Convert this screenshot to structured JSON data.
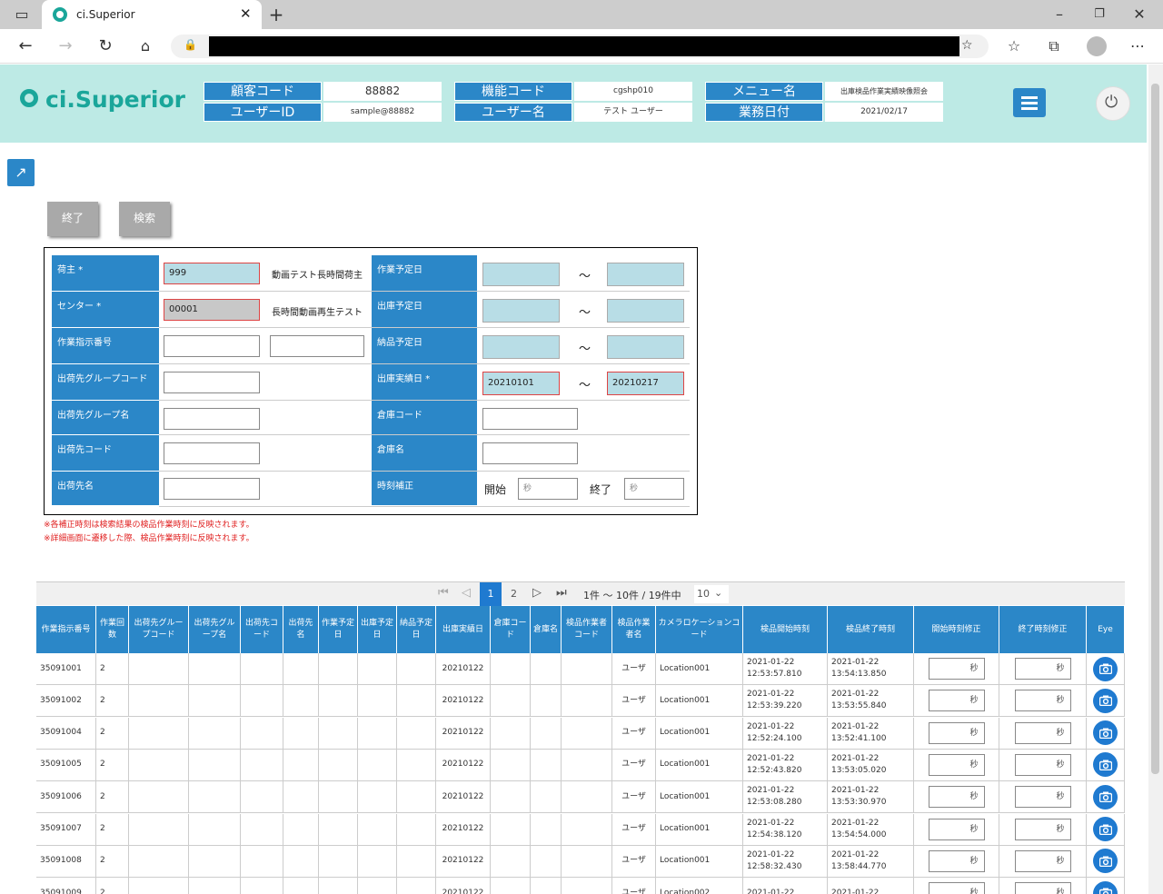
{
  "browser": {
    "tab_title": "ci.Superior"
  },
  "header": {
    "logo": "ci.Superior",
    "fields": [
      {
        "label": "顧客コード",
        "value": "88882"
      },
      {
        "label": "ユーザーID",
        "value": "sample@88882"
      },
      {
        "label": "機能コード",
        "value": "cgshp010"
      },
      {
        "label": "ユーザー名",
        "value": "テスト ユーザー"
      },
      {
        "label": "メニュー名",
        "value": "出庫検品作業実績映像照会"
      },
      {
        "label": "業務日付",
        "value": "2021/02/17"
      }
    ]
  },
  "toolbar": {
    "end_label": "終了",
    "search_label": "検索"
  },
  "form": {
    "shipper_label": "荷主 *",
    "shipper_value": "999",
    "shipper_name": "動画テスト長時間荷主",
    "center_label": "センター *",
    "center_value": "00001",
    "center_name": "長時間動画再生テスト",
    "work_order_label": "作業指示番号",
    "dest_group_code_label": "出荷先グループコード",
    "dest_group_name_label": "出荷先グループ名",
    "dest_code_label": "出荷先コード",
    "dest_name_label": "出荷先名",
    "work_sched_label": "作業予定日",
    "ship_sched_label": "出庫予定日",
    "deliv_sched_label": "納品予定日",
    "ship_actual_label": "出庫実績日 *",
    "ship_actual_from": "20210101",
    "ship_actual_to": "20210217",
    "warehouse_code_label": "倉庫コード",
    "warehouse_name_label": "倉庫名",
    "time_adj_label": "時刻補正",
    "start_label": "開始",
    "end_label": "終了",
    "sec_placeholder": "秒",
    "tilde": "～"
  },
  "notes": [
    "※各補正時刻は検索結果の検品作業時刻に反映されます。",
    "※詳細画面に遷移した際、検品作業時刻に反映されます。"
  ],
  "pager": {
    "current_page": "1",
    "next_page": "2",
    "summary": "1件 ～ 10件 / 19件中",
    "page_size": "10"
  },
  "table": {
    "headers": [
      "作業指示番号",
      "作業回数",
      "出荷先グループコード",
      "出荷先グループ名",
      "出荷先コード",
      "出荷先名",
      "作業予定日",
      "出庫予定日",
      "納品予定日",
      "出庫実績日",
      "倉庫コード",
      "倉庫名",
      "検品作業者コード",
      "検品作業者名",
      "カメラロケーションコード",
      "検品開始時刻",
      "検品終了時刻",
      "開始時刻修正",
      "終了時刻修正",
      "Eye"
    ],
    "sec_placeholder": "秒",
    "rows": [
      {
        "order": "35091001",
        "count": "2",
        "actual": "20210122",
        "worker": "ユーザ",
        "loc": "Location001",
        "start1": "2021-01-22",
        "start2": "12:53:57.810",
        "end1": "2021-01-22",
        "end2": "13:54:13.850"
      },
      {
        "order": "35091002",
        "count": "2",
        "actual": "20210122",
        "worker": "ユーザ",
        "loc": "Location001",
        "start1": "2021-01-22",
        "start2": "12:53:39.220",
        "end1": "2021-01-22",
        "end2": "13:53:55.840"
      },
      {
        "order": "35091004",
        "count": "2",
        "actual": "20210122",
        "worker": "ユーザ",
        "loc": "Location001",
        "start1": "2021-01-22",
        "start2": "12:52:24.100",
        "end1": "2021-01-22",
        "end2": "13:52:41.100"
      },
      {
        "order": "35091005",
        "count": "2",
        "actual": "20210122",
        "worker": "ユーザ",
        "loc": "Location001",
        "start1": "2021-01-22",
        "start2": "12:52:43.820",
        "end1": "2021-01-22",
        "end2": "13:53:05.020"
      },
      {
        "order": "35091006",
        "count": "2",
        "actual": "20210122",
        "worker": "ユーザ",
        "loc": "Location001",
        "start1": "2021-01-22",
        "start2": "12:53:08.280",
        "end1": "2021-01-22",
        "end2": "13:53:30.970"
      },
      {
        "order": "35091007",
        "count": "2",
        "actual": "20210122",
        "worker": "ユーザ",
        "loc": "Location001",
        "start1": "2021-01-22",
        "start2": "12:54:38.120",
        "end1": "2021-01-22",
        "end2": "13:54:54.000"
      },
      {
        "order": "35091008",
        "count": "2",
        "actual": "20210122",
        "worker": "ユーザ",
        "loc": "Location001",
        "start1": "2021-01-22",
        "start2": "12:58:32.430",
        "end1": "2021-01-22",
        "end2": "13:58:44.770"
      },
      {
        "order": "35091009",
        "count": "2",
        "actual": "20210122",
        "worker": "ユーザ",
        "loc": "Location002",
        "start1": "2021-01-22",
        "start2": "",
        "end1": "2021-01-22",
        "end2": ""
      }
    ]
  }
}
